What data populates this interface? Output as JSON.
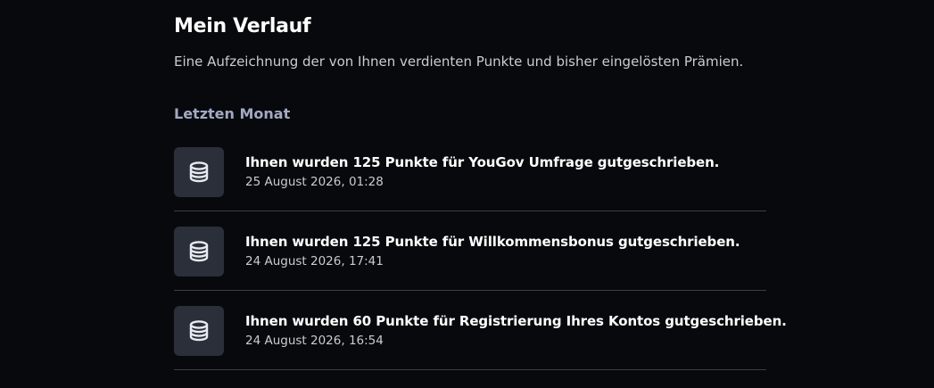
{
  "page": {
    "title": "Mein Verlauf",
    "subtitle": "Eine Aufzeichnung der von Ihnen verdienten Punkte und bisher eingelösten Prämien."
  },
  "section": {
    "heading": "Letzten Monat"
  },
  "items": [
    {
      "icon": "coins-icon",
      "title": "Ihnen wurden 125 Punkte für YouGov Umfrage gutgeschrieben.",
      "date": "25 August 2026, 01:28"
    },
    {
      "icon": "coins-icon",
      "title": "Ihnen wurden 125 Punkte für Willkommensbonus gutgeschrieben.",
      "date": "24 August 2026, 17:41"
    },
    {
      "icon": "coins-icon",
      "title": "Ihnen wurden 60 Punkte für Registrierung Ihres Kontos gutgeschrieben.",
      "date": "24 August 2026, 16:54"
    }
  ],
  "colors": {
    "background": "#08090c",
    "icon_tile": "#2a2f3a",
    "section_heading": "#a2a9c4",
    "divider": "#3b3e47"
  }
}
